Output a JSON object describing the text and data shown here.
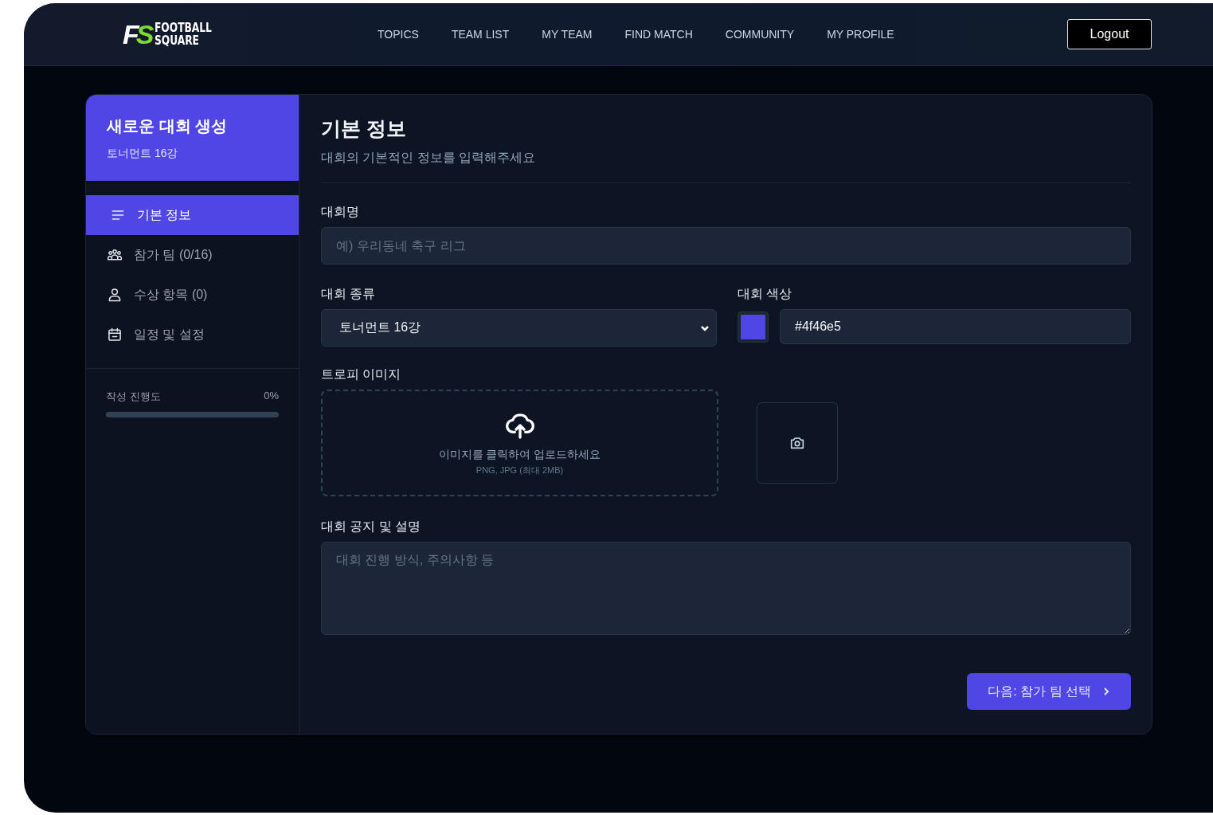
{
  "logo": {
    "mark_first": "F",
    "mark_second": "S",
    "name_line_1": "FOOTBALL",
    "name_line_2": "SQUARE"
  },
  "nav": {
    "links": [
      "TOPICS",
      "TEAM LIST",
      "MY TEAM",
      "FIND MATCH",
      "COMMUNITY",
      "MY PROFILE"
    ],
    "logout": "Logout"
  },
  "sidebar": {
    "title": "새로운 대회 생성",
    "subtitle": "토너먼트 16강",
    "items": [
      {
        "kind": "list",
        "label": "기본 정보",
        "selected": true
      },
      {
        "kind": "users",
        "label": "참가 팀 (0/16)",
        "selected": false
      },
      {
        "kind": "user",
        "label": "수상 항목 (0)",
        "selected": false
      },
      {
        "kind": "calendar",
        "label": "일정 및 설정",
        "selected": false
      }
    ],
    "progress": {
      "label": "작성 진행도",
      "reading": "0%",
      "level": 0
    }
  },
  "form": {
    "title": "기본 정보",
    "subtitle": "대회의 기본적인 정보를 입력해주세요",
    "name": {
      "label": "대회명",
      "placeholder": "예) 우리동네 축구 리그"
    },
    "type": {
      "label": "대회 종류",
      "value": "토너먼트 16강"
    },
    "color": {
      "label": "대회 색상",
      "color": "#4f46e5",
      "value": "#4f46e5"
    },
    "trophy": {
      "label": "트로피 이미지",
      "upload_text": "이미지를 클릭하여 업로드하세요",
      "hint": "PNG, JPG (최대 2MB)"
    },
    "description": {
      "label": "대회 공지 및 설명",
      "placeholder": "대회 진행 방식, 주의사항 등"
    },
    "next_button": "다음: 참가 팀 선택"
  }
}
